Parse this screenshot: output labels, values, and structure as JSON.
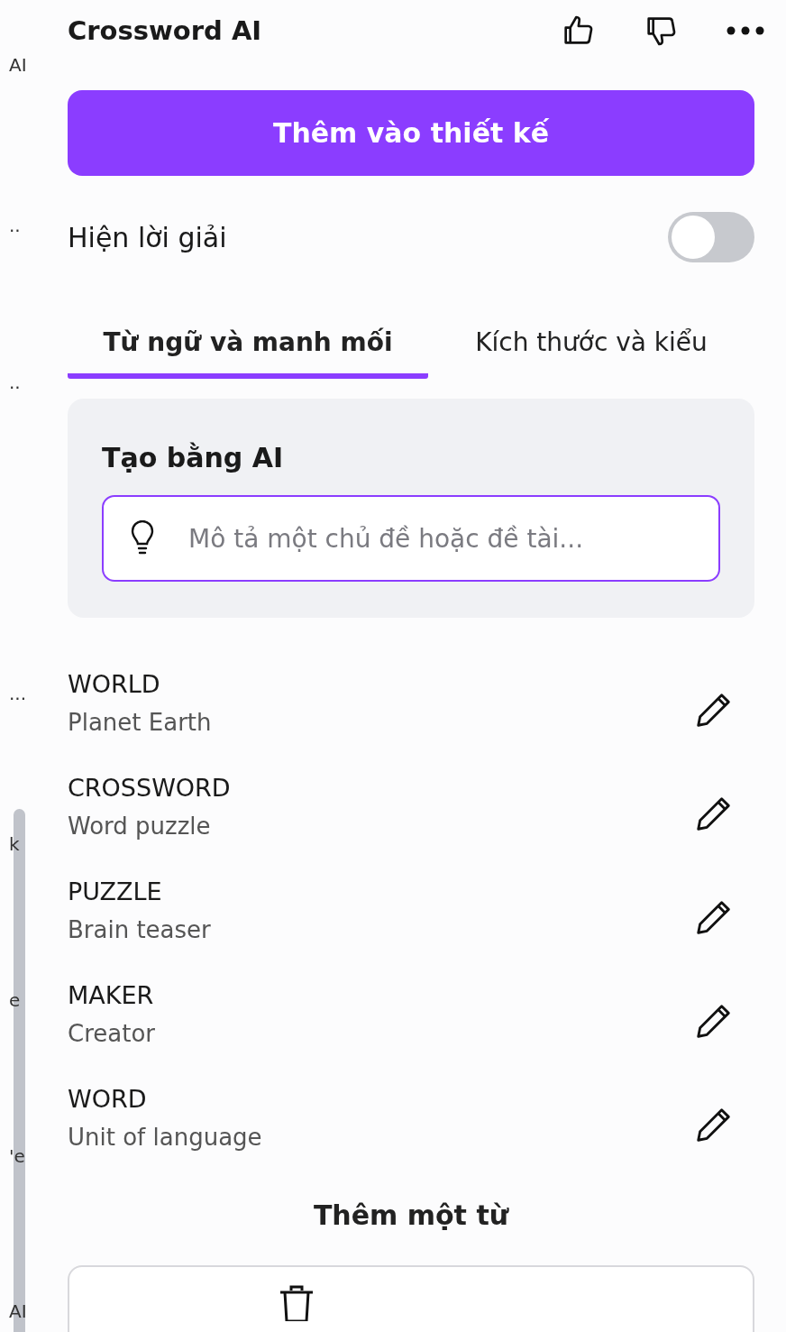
{
  "left_edge_fragments": [
    "AI",
    "..",
    "..",
    "...",
    "k",
    "e",
    "'e",
    "AI"
  ],
  "header": {
    "title": "Crossword AI"
  },
  "add_button": {
    "label": "Thêm vào thiết kế"
  },
  "show_answers": {
    "label": "Hiện lời giải",
    "on": false
  },
  "tabs": [
    {
      "label": "Từ ngữ và manh mối",
      "selected": true
    },
    {
      "label": "Kích thước và kiểu",
      "selected": false
    }
  ],
  "ai_card": {
    "title": "Tạo bằng AI",
    "placeholder": "Mô tả một chủ đề hoặc đề tài..."
  },
  "words": [
    {
      "word": "WORLD",
      "clue": "Planet Earth"
    },
    {
      "word": "CROSSWORD",
      "clue": "Word puzzle"
    },
    {
      "word": "PUZZLE",
      "clue": "Brain teaser"
    },
    {
      "word": "MAKER",
      "clue": "Creator"
    },
    {
      "word": "WORD",
      "clue": "Unit of language"
    }
  ],
  "add_word": {
    "label": "Thêm một từ"
  }
}
